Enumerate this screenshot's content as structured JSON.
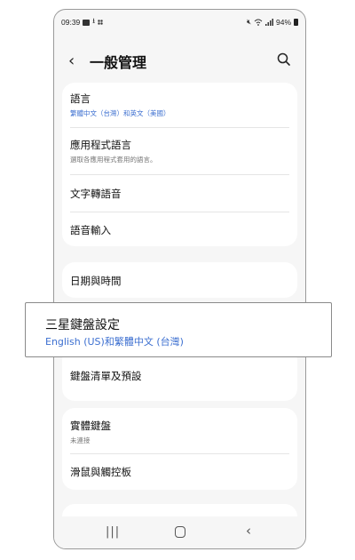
{
  "status": {
    "time": "09:39",
    "battery": "94%"
  },
  "header": {
    "title": "一般管理"
  },
  "card1": {
    "items": [
      {
        "label": "語言",
        "sub": "繁體中文（台灣）和英文（美國）"
      },
      {
        "label": "應用程式語言",
        "sub": "選取各應用程式套用的語言。"
      },
      {
        "label": "文字轉語音"
      },
      {
        "label": "語音輸入"
      }
    ]
  },
  "card2": {
    "items": [
      {
        "label": "日期與時間"
      }
    ]
  },
  "popup": {
    "title": "三星鍵盤設定",
    "subtitle": "English (US)和繁體中文 (台灣)"
  },
  "card3": {
    "items": [
      {
        "label": "鍵盤清單及預設"
      }
    ]
  },
  "card4": {
    "items": [
      {
        "label": "實體鍵盤",
        "sub": "未連接"
      },
      {
        "label": "滑鼠與觸控板"
      }
    ]
  },
  "navbar": {
    "recent_glyph": "|||",
    "back_glyph": "‹"
  }
}
